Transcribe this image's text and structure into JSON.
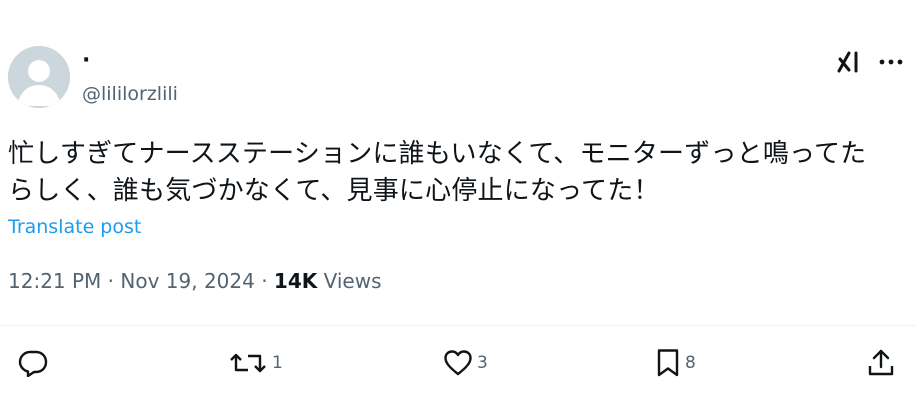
{
  "author": {
    "display_name": "·",
    "handle": "@lililorzlili"
  },
  "header_icons": [
    "grok-icon",
    "more-icon"
  ],
  "post": {
    "text_line1": "忙しすぎてナースステーションに誰もいなくて、モニターずっと鳴ってた",
    "text_line2": "らしく、誰も気づかなくて、見事に心停止になってた！",
    "translate_label": "Translate post"
  },
  "meta": {
    "time": "12:21 PM",
    "separator": "·",
    "date": "Nov 19, 2024",
    "views_count": "14K",
    "views_label": "Views"
  },
  "actions": {
    "reply": {
      "icon": "reply-icon",
      "count": ""
    },
    "repost": {
      "icon": "repost-icon",
      "count": "1"
    },
    "like": {
      "icon": "heart-icon",
      "count": "3"
    },
    "bookmark": {
      "icon": "bookmark-icon",
      "count": "8"
    },
    "share": {
      "icon": "share-icon",
      "count": ""
    }
  },
  "colors": {
    "text": "#0f1419",
    "secondary": "#536471",
    "link": "#1d9bf0",
    "avatar_bg": "#ccd6dd"
  }
}
